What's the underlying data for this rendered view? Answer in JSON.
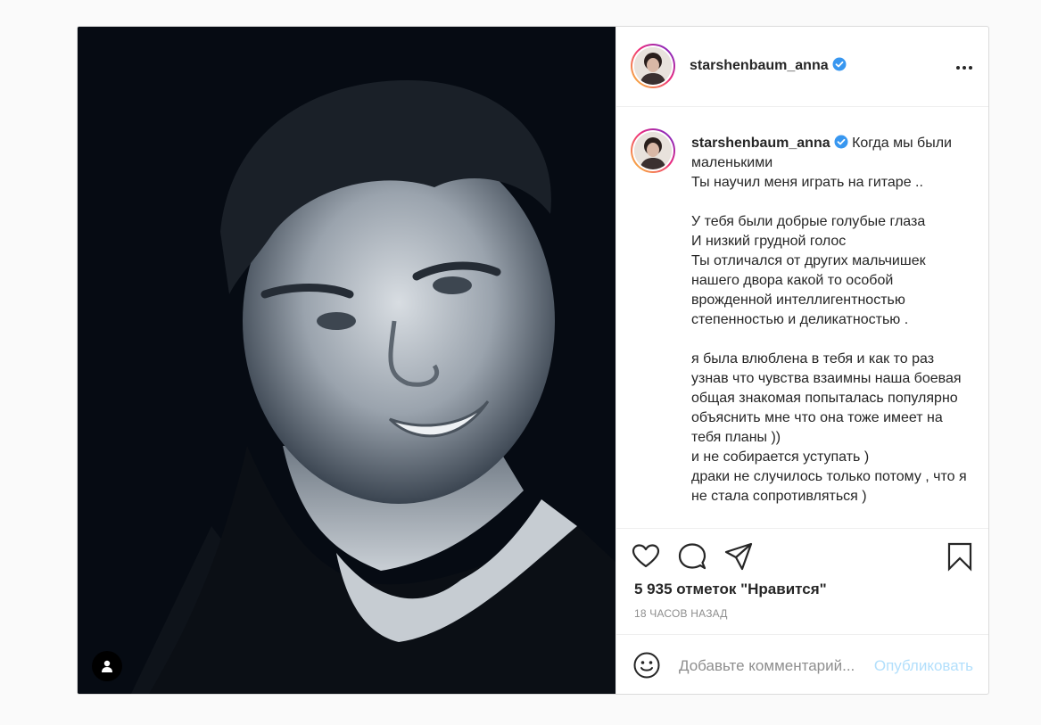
{
  "post": {
    "username": "starshenbaum_anna",
    "verified": true,
    "caption": "Когда мы были маленькими\nТы научил меня играть на гитаре ..\n\nУ тебя были добрые голубые глаза\nИ низкий грудной голос\nТы отличался от других мальчишек нашего двора какой то особой врожденной интеллигентностью степенностью и деликатностью .\n\nя была влюблена в тебя и как то раз узнав что чувства взаимны наша боевая общая знакомая попыталась популярно объяснить мне что она тоже имеет на тебя планы ))\nи не собирается уступать )\nдраки не случилось только потому , что я не стала сопротивляться )",
    "likes": "5 935 отметок \"Нравится\"",
    "timestamp": "18 ЧАСОВ НАЗАД"
  },
  "comment": {
    "placeholder": "Добавьте комментарий...",
    "publish_label": "Опубликовать"
  },
  "colors": {
    "verified": "#3897f0",
    "publish": "#b2dffc",
    "muted": "#8e8e8e"
  },
  "icons": [
    "tag-user-icon",
    "verified-icon",
    "more-icon",
    "heart-icon",
    "comment-icon",
    "share-icon",
    "bookmark-icon",
    "emoji-icon"
  ]
}
